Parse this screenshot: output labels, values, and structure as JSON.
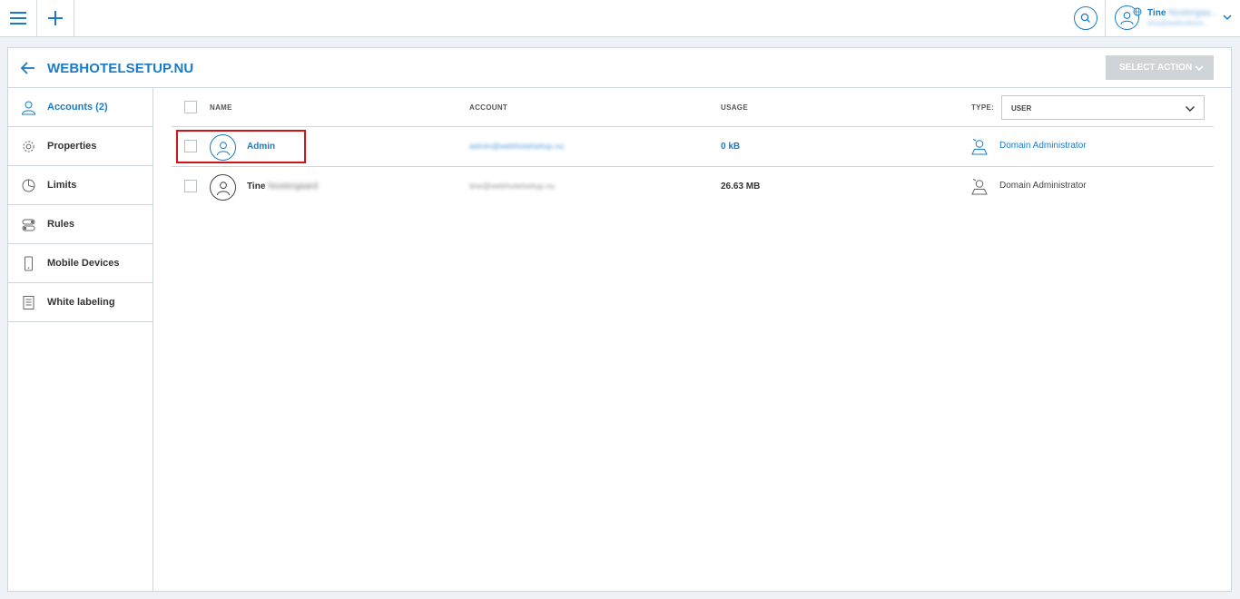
{
  "topbar": {
    "menu_icon": "hamburger-icon",
    "add_icon": "plus-icon",
    "search_icon": "search-icon",
    "user_first_name": "Tine",
    "user_last_name_blurred": "Nostergaa...",
    "user_email_blurred": "tine@webhotelse..."
  },
  "header": {
    "title": "WEBHOTELSETUP.NU",
    "select_action_label": "SELECT ACTION"
  },
  "sidebar": {
    "items": [
      {
        "label": "Accounts (2)",
        "icon": "user-icon",
        "active": true
      },
      {
        "label": "Properties",
        "icon": "gear-icon",
        "active": false
      },
      {
        "label": "Limits",
        "icon": "pie-chart-icon",
        "active": false
      },
      {
        "label": "Rules",
        "icon": "toggle-icon",
        "active": false
      },
      {
        "label": "Mobile Devices",
        "icon": "phone-icon",
        "active": false
      },
      {
        "label": "White labeling",
        "icon": "document-icon",
        "active": false
      }
    ]
  },
  "table": {
    "columns": {
      "name": "NAME",
      "account": "ACCOUNT",
      "usage": "USAGE",
      "type": "TYPE:"
    },
    "type_filter_value": "USER",
    "rows": [
      {
        "first_name": "Admin",
        "last_name_blurred": "",
        "account_blurred": "admin@webhotelsetup.nu",
        "usage": "0 kB",
        "type": "Domain Administrator",
        "highlighted": true
      },
      {
        "first_name": "Tine",
        "last_name_blurred": "Nostergaard",
        "account_blurred": "tine@webhotelsetup.nu",
        "usage": "26.63 MB",
        "type": "Domain Administrator",
        "highlighted": false
      }
    ]
  },
  "colors": {
    "accent": "#1a7bc4",
    "highlight_border": "#d0131a",
    "disabled_button": "#cfd4d9"
  }
}
